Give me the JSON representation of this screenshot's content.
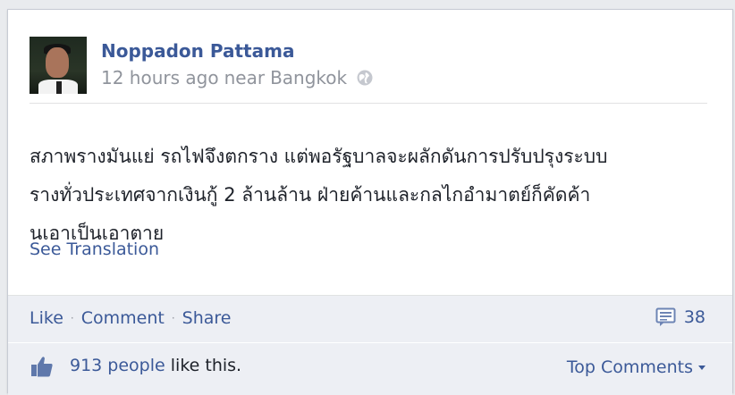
{
  "post": {
    "author": "Noppadon Pattama",
    "time": "12 hours ago",
    "location_prefix": "near",
    "location": "Bangkok",
    "text_lines": [
      "สภาพรางมันแย่ รถไฟจึงตกราง แต่พอรัฐบาลจะผลักดันการปรับปรุงระบบ",
      "รางทั่วประเทศจากเงินกู้ 2 ล้านล้าน ฝ่ายค้านและกลไกอำมาตย์ก็คัดค้า",
      "นเอาเป็นเอาตาย"
    ],
    "see_translation": "See Translation"
  },
  "actions": {
    "like": "Like",
    "comment": "Comment",
    "share": "Share",
    "separator": "·",
    "comments_count": "38"
  },
  "likes": {
    "count_text": "913 people",
    "suffix": " like this.",
    "top_comments": "Top Comments"
  },
  "colors": {
    "link": "#3b5998",
    "background": "#edeff4"
  },
  "icons": {
    "globe": "globe-icon",
    "comments": "comment-bubble-icon",
    "like": "thumbs-up-icon",
    "caret": "chevron-down-icon"
  }
}
